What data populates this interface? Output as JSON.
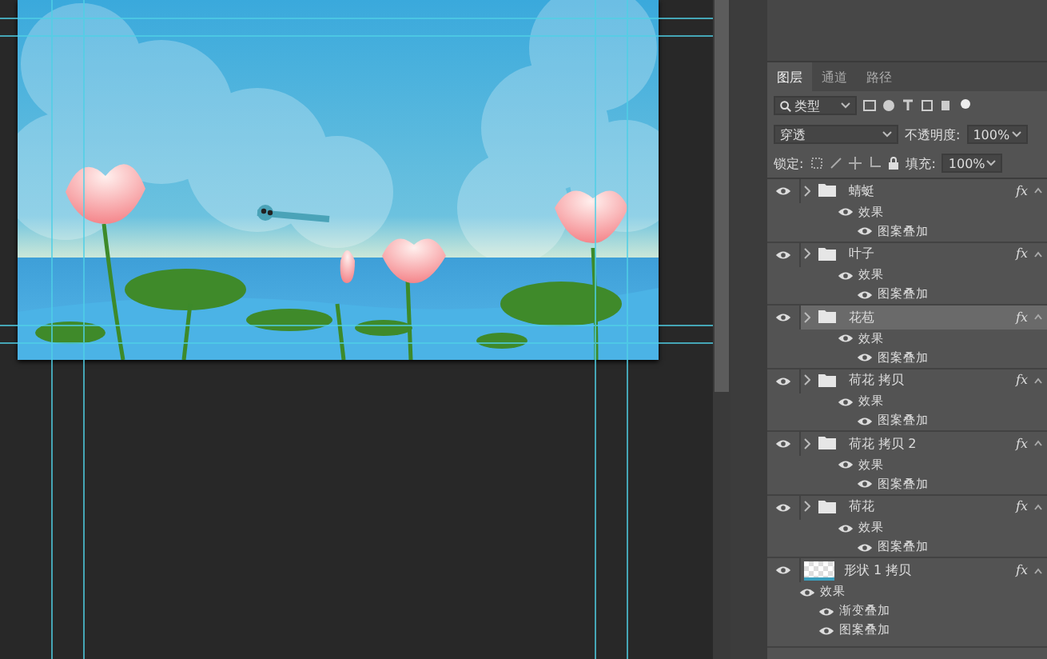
{
  "panel": {
    "tabs": [
      {
        "label": "图层",
        "selected": true
      },
      {
        "label": "通道",
        "selected": false
      },
      {
        "label": "路径",
        "selected": false
      }
    ],
    "filter": {
      "label": "类型"
    },
    "blend_mode": "穿透",
    "opacity": {
      "label": "不透明度:",
      "value": "100%"
    },
    "lock": {
      "label": "锁定:"
    },
    "fill": {
      "label": "填充:",
      "value": "100%"
    }
  },
  "layers": [
    {
      "name": "蜻蜓",
      "kind": "group",
      "selected": false,
      "visible": true,
      "fx": "fx",
      "effects_label": "效果",
      "effects": [
        "图案叠加"
      ]
    },
    {
      "name": "叶子",
      "kind": "group",
      "selected": false,
      "visible": true,
      "fx": "fx",
      "effects_label": "效果",
      "effects": [
        "图案叠加"
      ]
    },
    {
      "name": "花苞",
      "kind": "group",
      "selected": true,
      "visible": true,
      "fx": "fx",
      "effects_label": "效果",
      "effects": [
        "图案叠加"
      ]
    },
    {
      "name": "荷花 拷贝",
      "kind": "group",
      "selected": false,
      "visible": true,
      "fx": "fx",
      "effects_label": "效果",
      "effects": [
        "图案叠加"
      ]
    },
    {
      "name": "荷花 拷贝 2",
      "kind": "group",
      "selected": false,
      "visible": true,
      "fx": "fx",
      "effects_label": "效果",
      "effects": [
        "图案叠加"
      ]
    },
    {
      "name": "荷花",
      "kind": "group",
      "selected": false,
      "visible": true,
      "fx": "fx",
      "effects_label": "效果",
      "effects": [
        "图案叠加"
      ]
    },
    {
      "name": "形状 1 拷贝",
      "kind": "shape",
      "selected": false,
      "visible": true,
      "fx": "fx",
      "effects_label": "效果",
      "effects": [
        "渐变叠加",
        "图案叠加"
      ]
    }
  ]
}
